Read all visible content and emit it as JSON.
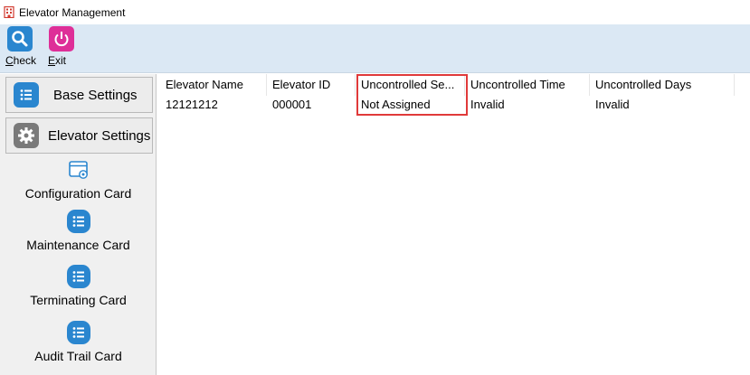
{
  "window": {
    "title": "Elevator Management",
    "icon": "building-icon"
  },
  "toolbar": {
    "check": {
      "mnemonic": "C",
      "rest": "heck",
      "icon": "search-icon"
    },
    "exit": {
      "mnemonic": "E",
      "rest": "xit",
      "icon": "power-icon"
    }
  },
  "sidebar": {
    "base_settings": {
      "label": "Base Settings",
      "icon": "list-icon"
    },
    "elevator_settings": {
      "label": "Elevator Settings",
      "icon": "gear-icon"
    },
    "items": [
      {
        "label": "Configuration Card",
        "icon": "card-settings-icon"
      },
      {
        "label": "Maintenance Card",
        "icon": "list-icon"
      },
      {
        "label": "Terminating Card",
        "icon": "list-icon"
      },
      {
        "label": "Audit Trail Card",
        "icon": "list-icon"
      }
    ]
  },
  "table": {
    "columns": [
      "Elevator Name",
      "Elevator ID",
      "Uncontrolled Se...",
      "Uncontrolled Time",
      "Uncontrolled Days"
    ],
    "rows": [
      [
        "12121212",
        "000001",
        "Not Assigned",
        "Invalid",
        "Invalid"
      ]
    ]
  },
  "colors": {
    "toolbar_bg": "#dbe8f4",
    "accent_blue": "#2a86cf",
    "exit_pink": "#de2f98",
    "highlight_red": "#e03a3a"
  }
}
